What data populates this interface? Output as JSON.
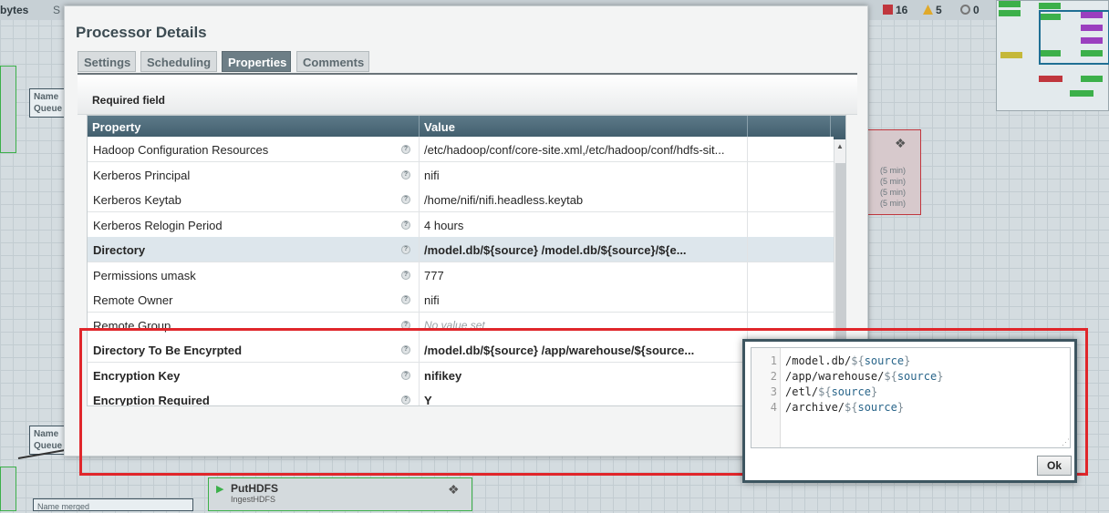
{
  "canvas": {
    "top_label": "bytes",
    "top_label_2": "S",
    "stats": {
      "stopped": "16",
      "invalid": "5",
      "disabled": "0"
    },
    "queue_label_1": "Name\nQueue",
    "queue_label_2": "Name\nQueue",
    "proc_times": [
      "(5 min)",
      "(5 min)",
      "(5 min)",
      "(5 min)"
    ],
    "puthdfs": {
      "name": "PutHDFS",
      "sub": "IngestHDFS"
    },
    "merged_label": "Name merged"
  },
  "dialog": {
    "title": "Processor Details",
    "tabs": [
      "Settings",
      "Scheduling",
      "Properties",
      "Comments"
    ],
    "active_tab": "Properties",
    "required_field": "Required field",
    "columns": {
      "property": "Property",
      "value": "Value"
    },
    "rows": [
      {
        "name": "Hadoop Configuration Resources",
        "value": "/etc/hadoop/conf/core-site.xml,/etc/hadoop/conf/hdfs-sit...",
        "bold": false
      },
      {
        "name": "Kerberos Principal",
        "value": "nifi",
        "bold": false
      },
      {
        "name": "Kerberos Keytab",
        "value": "/home/nifi/nifi.headless.keytab",
        "bold": false
      },
      {
        "name": "Kerberos Relogin Period",
        "value": "4 hours",
        "bold": false
      },
      {
        "name": "Directory",
        "value": "/model.db/${source} /model.db/${source}/${e...",
        "bold": true,
        "selected": true
      },
      {
        "name": "Permissions umask",
        "value": "777",
        "bold": false
      },
      {
        "name": "Remote Owner",
        "value": "nifi",
        "bold": false
      },
      {
        "name": "Remote Group",
        "value": "No value set",
        "bold": false,
        "empty": true
      },
      {
        "name": "Directory To Be Encyrpted",
        "value": "/model.db/${source} /app/warehouse/${source...",
        "bold": true
      },
      {
        "name": "Encryption Key",
        "value": "nifikey",
        "bold": true
      },
      {
        "name": "Encryption Required",
        "value": "Y",
        "bold": true
      }
    ]
  },
  "editor": {
    "lines": [
      {
        "num": "1",
        "text": "/model.db/",
        "expr": "source"
      },
      {
        "num": "2",
        "text": "/app/warehouse/",
        "expr": "source"
      },
      {
        "num": "3",
        "text": "/etl/",
        "expr": "source"
      },
      {
        "num": "4",
        "text": "/archive/",
        "expr": "source"
      }
    ],
    "ok_label": "Ok"
  },
  "colors": {
    "highlight": "#e0262b",
    "header": "#4a6776",
    "selected_row": "#dde6ec"
  }
}
